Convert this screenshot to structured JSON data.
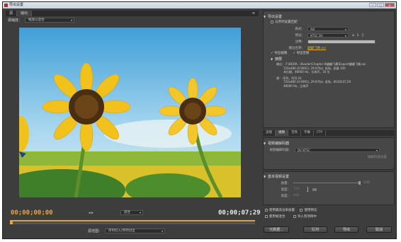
{
  "window": {
    "title": "导出设置",
    "min": "—",
    "max": "□",
    "close": "✕"
  },
  "left": {
    "tabs": [
      "源",
      "输出"
    ],
    "source_scale_label": "源缩放：",
    "source_scale_value": "缩放以适合",
    "timecode_start": "00;00;00;00",
    "timecode_end": "00;00;07;29",
    "fit_value": "适合",
    "source_range_label": "源范围：",
    "source_range_value": "序列切入/序列切出"
  },
  "right": {
    "export_settings_header": "导出设置",
    "match_sequence_label": "与序列设置匹配",
    "format_label": "格式：",
    "format_value": "AVI",
    "preset_label": "预设：",
    "preset_value": "NTSC DV",
    "comment_label": "注释：",
    "output_name_label": "输出名称：",
    "output_name_value": "翩翩飞舞.avi",
    "export_video_label": "导出视频",
    "export_audio_label": "导出音频",
    "summary_header": "摘要",
    "summary_output_label": "输出：",
    "summary_output": [
      "F:\\BOOK...\\Reader\\Chapter 8\\翩翩飞舞\\Export\\翩翩飞舞.avi",
      "720x480 (0.9091), 29.97fps, 低场，质量 100",
      "未压缩，48000 Hz，立体声，16 位"
    ],
    "summary_source_label": "源：",
    "summary_source": [
      "序列，序列 01",
      "720x480 (0.9091), 29.97fps, 低场，00;00;07;29",
      "48000 Hz，立体声"
    ],
    "subtabs": [
      "滤镜",
      "视频",
      "音频",
      "字幕",
      "FTP"
    ],
    "video_codec_header": "视频编解码器",
    "video_codec_label": "视频编解码器：",
    "video_codec_value": "DV NTSC",
    "codec_settings_button": "编解码器设置",
    "basic_video_header": "基本视频设置",
    "quality_label": "质量：",
    "quality_value": "100",
    "width_label": "宽度：",
    "width_value": "720",
    "height_label": "高度：",
    "height_value": "480",
    "max_render_quality": "使用最高渲染质量",
    "use_preview": "使用预览",
    "use_frame_blending": "使用帧混合",
    "import_into_project": "导入到项目中",
    "metadata_button": "元数据...",
    "queue_button": "队列",
    "export_button": "导出",
    "cancel_button": "取消"
  }
}
